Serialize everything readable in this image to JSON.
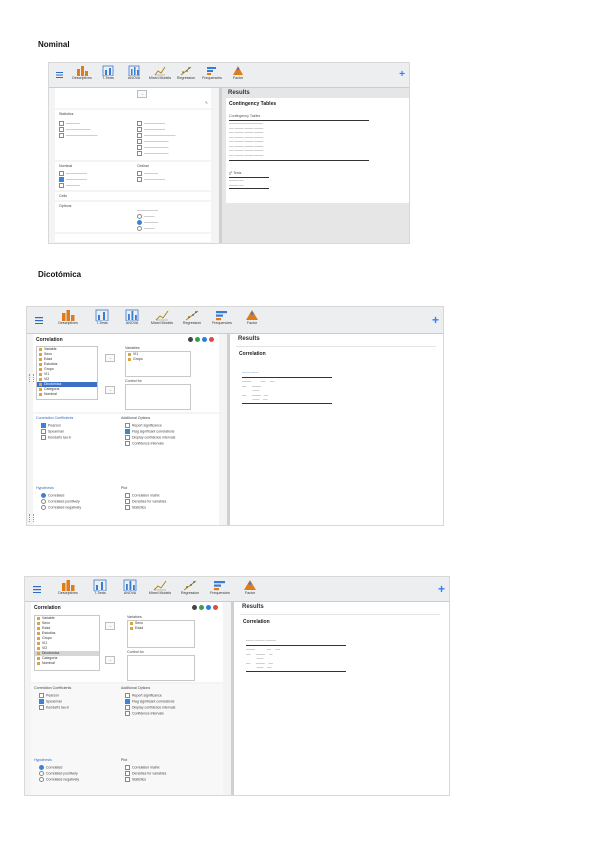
{
  "sections": {
    "nominal": "Nominal",
    "dichotomous": "Dicotómica"
  },
  "toolbar": {
    "tools": [
      "Descriptives",
      "T-Tests",
      "ANOVA",
      "Mixed Models",
      "Regression",
      "Frequencies",
      "Factor"
    ],
    "add_icon": "plus-icon",
    "menu_icon": "hamburger-icon"
  },
  "colors": {
    "accent": "#2b80ff",
    "selection": "#3d6fc7",
    "variable_icon": "#d9a441",
    "toolbar": "#eceef0"
  },
  "panel1": {
    "results_title": "Results",
    "table_title": "Contingency Tables",
    "sub_title": "Contingency Tables",
    "test_title": "χ² Tests",
    "sections": [
      "Statistics",
      "Nominal",
      "Ordinal",
      "Cells",
      "Options"
    ]
  },
  "panel2": {
    "analysis_title": "Correlation",
    "results_title": "Results",
    "results_heading": "Correlation",
    "variables": [
      "Variable",
      "Sexo",
      "Edad",
      "Estudios",
      "Grupo",
      "VI1",
      "VI2",
      "Dicotómica",
      "Categoría",
      "Nominal"
    ],
    "selected_variable": "Dicotómica",
    "target_label": "Variables",
    "target_items": [
      "VI1",
      "Grupo"
    ],
    "partial_label": "Control for",
    "coef_label": "Correlation Coefficients",
    "coefs": [
      {
        "label": "Pearson",
        "on": true
      },
      {
        "label": "Spearman",
        "on": false
      },
      {
        "label": "Kendall's tau-b",
        "on": false
      }
    ],
    "add_label": "Additional Options",
    "add_opts": [
      {
        "label": "Report significance",
        "on": false
      },
      {
        "label": "Flag significant correlations",
        "on": true
      },
      {
        "label": "Display confidence intervals",
        "on": false
      },
      {
        "label": "Confidence intervals",
        "on": false
      }
    ],
    "hyp_label": "Hypothesis",
    "hyp_opts": [
      {
        "label": "Correlated",
        "on": true
      },
      {
        "label": "Correlated positively",
        "on": false
      },
      {
        "label": "Correlated negatively",
        "on": false
      }
    ],
    "plot_label": "Plot",
    "plot_opts": [
      "Correlation matrix",
      "Densities for variables",
      "Statistics"
    ]
  },
  "panel3": {
    "analysis_title": "Correlation",
    "results_title": "Results",
    "results_heading": "Correlation",
    "variables": [
      "Variable",
      "Sexo",
      "Edad",
      "Estudios",
      "Grupo",
      "VI1",
      "VI2",
      "Dicotómica",
      "Categoría",
      "Nominal"
    ],
    "selected_variable": "Dicotómica",
    "target_label": "Variables",
    "target_items": [
      "Sexo",
      "Edad"
    ],
    "partial_label": "Control for",
    "coef_label": "Correlation Coefficients",
    "coefs": [
      {
        "label": "Pearson",
        "on": true
      },
      {
        "label": "Spearman",
        "on": false
      },
      {
        "label": "Kendall's tau-b",
        "on": false
      }
    ],
    "add_label": "Additional Options",
    "add_opts": [
      {
        "label": "Report significance",
        "on": false
      },
      {
        "label": "Flag significant correlations",
        "on": true
      },
      {
        "label": "Display confidence intervals",
        "on": false
      },
      {
        "label": "Confidence intervals",
        "on": false
      }
    ],
    "hyp_label": "Hypothesis",
    "hyp_opts": [
      {
        "label": "Correlated",
        "on": true
      },
      {
        "label": "Correlated positively",
        "on": false
      },
      {
        "label": "Correlated negatively",
        "on": false
      }
    ],
    "plot_label": "Plot",
    "plot_opts": [
      "Correlation matrix",
      "Densities for variables",
      "Statistics"
    ]
  }
}
